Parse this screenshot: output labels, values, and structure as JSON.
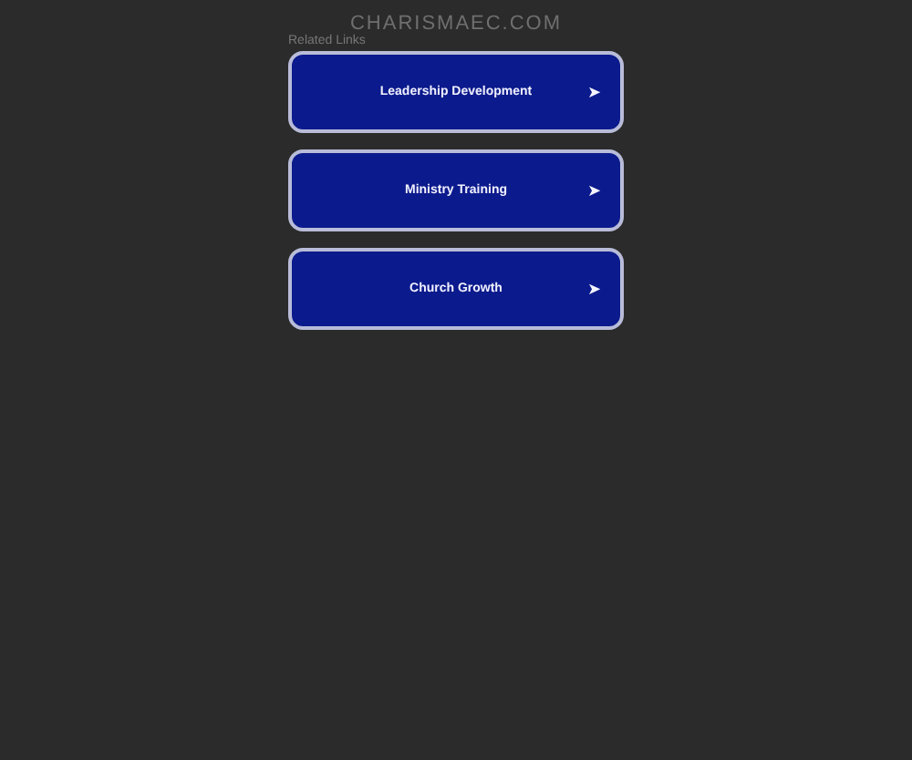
{
  "header": {
    "title": "CHARISMAEC.COM"
  },
  "section": {
    "label": "Related Links"
  },
  "links": [
    {
      "label": "Leadership Development",
      "arrow": "➤"
    },
    {
      "label": "Ministry Training",
      "arrow": "➤"
    },
    {
      "label": "Church Growth",
      "arrow": "➤"
    }
  ]
}
